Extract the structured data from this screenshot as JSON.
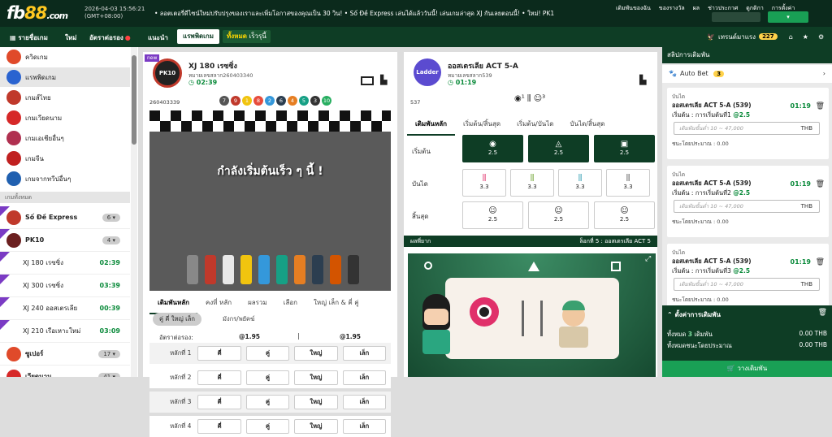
{
  "header": {
    "logo_a": "fb",
    "logo_b": "88",
    "logo_c": ".com",
    "datetime": "2026-04-03 15:56:21",
    "timezone": "(GMT+08:00)",
    "ticker": "• ลอตเตอรี่ดีไซน์ใหม่ปรับปรุงของเราและเพิ่มโอกาสของคุณเป็น 30 วิน! • Số Đề Express เล่นได้แล้ววันนี้! เล่นเกมล่าสุด XJ กันเลยตอนนี้! • ใหม่! PK1",
    "links": [
      "เดิมพันของฉัน",
      "ของรางวัล",
      "ผล",
      "ช่าวประกาศ",
      "ดูกติกา",
      "การตั้งค่า"
    ]
  },
  "nav": {
    "items": [
      "รายชื่อเกม",
      "ใหม่",
      "อัตราต่อรอง",
      "แนะนำ"
    ],
    "tab_ticket": "แรพพิดเกม",
    "tab_fast_a": "ทั้งหมด",
    "tab_fast_b": "เร็วรุนี้",
    "credit_label": "เทรนด์มาแรง",
    "credit_count": "227"
  },
  "sidebar": {
    "menu": [
      {
        "label": "ควิดเกม",
        "color": "#e04a2a"
      },
      {
        "label": "แรพพิดเกม",
        "color": "#2a63d0"
      },
      {
        "label": "เกมส์ไทย",
        "color": "#c0392b"
      },
      {
        "label": "เกมเวียดนาม",
        "color": "#d62828"
      },
      {
        "label": "เกมเอเชียอื่นๆ",
        "color": "#b03050"
      },
      {
        "label": "เกมจีน",
        "color": "#c02020"
      },
      {
        "label": "เกมจากทวีปอื่นๆ",
        "color": "#2060b0"
      }
    ],
    "section_label": "เกมทั้งหมด",
    "games": [
      {
        "name": "Số Đề Express",
        "count": "6"
      },
      {
        "name": "PK10",
        "count": "4"
      }
    ],
    "subgames": [
      {
        "name": "XJ 180 เรซซิ่ง",
        "time": "02:39"
      },
      {
        "name": "XJ 300 เรซซิ่ง",
        "time": "03:39"
      },
      {
        "name": "XJ 240 ออสเตรเลีย",
        "time": "00:39"
      },
      {
        "name": "XJ 210 เรือเหาะใหม่",
        "time": "03:09"
      }
    ],
    "more": [
      {
        "name": "ซูเปอร์",
        "count": "17"
      },
      {
        "name": "เวียดนาม",
        "count": "41"
      }
    ]
  },
  "panel1": {
    "title": "XJ 180 เรซซิ่ง",
    "draw_label": "หมายเลขสลาก260403340",
    "time": "02:39",
    "prev_draw": "260403339",
    "balls": [
      {
        "n": "7",
        "c": "#555"
      },
      {
        "n": "9",
        "c": "#c0392b"
      },
      {
        "n": "1",
        "c": "#f1c40f"
      },
      {
        "n": "8",
        "c": "#e74c3c"
      },
      {
        "n": "2",
        "c": "#3498db"
      },
      {
        "n": "6",
        "c": "#2c3e50"
      },
      {
        "n": "4",
        "c": "#e67e22"
      },
      {
        "n": "5",
        "c": "#16a085"
      },
      {
        "n": "3",
        "c": "#333"
      },
      {
        "n": "10",
        "c": "#27ae60"
      }
    ],
    "race_message": "กำลังเริ่มต้นเร็ว ๆ นี้ !",
    "tabs": [
      "เดิมพันหลัก",
      "คงที่ หลัก",
      "ผลรวม",
      "เลือก",
      "ใหญ่ เล็ก & คี่ คู่"
    ],
    "pills": [
      "คู่ คี่ ใหญ่ เล็ก",
      "มังกร/พยัคฆ์"
    ],
    "odds_label": "อัตราต่อรอง:",
    "odds_a": "@1.95",
    "odds_b": "@1.95",
    "rows": [
      {
        "label": "หลักที่ 1",
        "btns": [
          "คี่",
          "คู่",
          "ใหญ่",
          "เล็ก"
        ]
      },
      {
        "label": "หลักที่ 2",
        "btns": [
          "คี่",
          "คู่",
          "ใหญ่",
          "เล็ก"
        ]
      },
      {
        "label": "หลักที่ 3",
        "btns": [
          "คี่",
          "คู่",
          "ใหญ่",
          "เล็ก"
        ]
      },
      {
        "label": "หลักที่ 4",
        "btns": [
          "คี่",
          "คู่",
          "ใหญ่",
          "เล็ก"
        ]
      }
    ]
  },
  "panel2": {
    "title": "ออสเตรเลีย ACT 5-A",
    "draw_label": "หมายเลขสลาก539",
    "time": "01:19",
    "prev_draw": "537",
    "tabs": [
      "เดิมพันหลัก",
      "เริ่มต้น/สิ้นสุด",
      "เริ่มต้น/บันได",
      "บันได/สิ้นสุด"
    ],
    "start_label": "เริ่มต้น",
    "ladder_label": "บันได",
    "end_label": "สิ้นสุด",
    "start_odds": [
      "2.5",
      "2.5",
      "2.5"
    ],
    "ladder_odds": [
      "3.3",
      "3.3",
      "3.3",
      "3.3"
    ],
    "end_odds": [
      "2.5",
      "2.5",
      "2.5"
    ],
    "video_bar_left": "ผลพี่ยาก",
    "video_bar_right": "ล็อกที่ 5 : ออสเตรเลีย ACT 5"
  },
  "betslip": {
    "title": "สลิปการเดิมพัน",
    "autobet": "Auto Bet",
    "autobet_count": "3",
    "cards": [
      {
        "type": "บันได",
        "name": "ออสเตรเลีย ACT 5-A (539)",
        "sel_a": "เริ่มต้น : การเริ่มต้นที่1",
        "sel_b": "@2.5",
        "time": "01:19",
        "placeholder": "เดิมพันขั้นต่ำ 10 ~ 47,000",
        "cur": "THB",
        "expect": "ชนะโดยประมาณ : 0.00"
      },
      {
        "type": "บันได",
        "name": "ออสเตรเลีย ACT 5-A (539)",
        "sel_a": "เริ่มต้น : การเริ่มต้นที่2",
        "sel_b": "@2.5",
        "time": "01:19",
        "placeholder": "เดิมพันขั้นต่ำ 10 ~ 47,000",
        "cur": "THB",
        "expect": "ชนะโดยประมาณ : 0.00"
      },
      {
        "type": "บันได",
        "name": "ออสเตรเลีย ACT 5-A (539)",
        "sel_a": "เริ่มต้น : การเริ่มต้นที่3",
        "sel_b": "@2.5",
        "time": "01:19",
        "placeholder": "เดิมพันขั้นต่ำ 10 ~ 47,000",
        "cur": "THB",
        "expect": "ชนะโดยประมาณ : 0.00"
      }
    ],
    "summary_title": "ตั้งค่าการเดิมพัน",
    "total_label": "ทั้งหมด",
    "total_count": "3",
    "total_unit": "เดิมพัน",
    "total_value": "0.00 THB",
    "est_label": "ทั้งหมดชนะโดยประมาณ",
    "est_value": "0.00 THB",
    "place_button": "วางเดิมพัน"
  }
}
